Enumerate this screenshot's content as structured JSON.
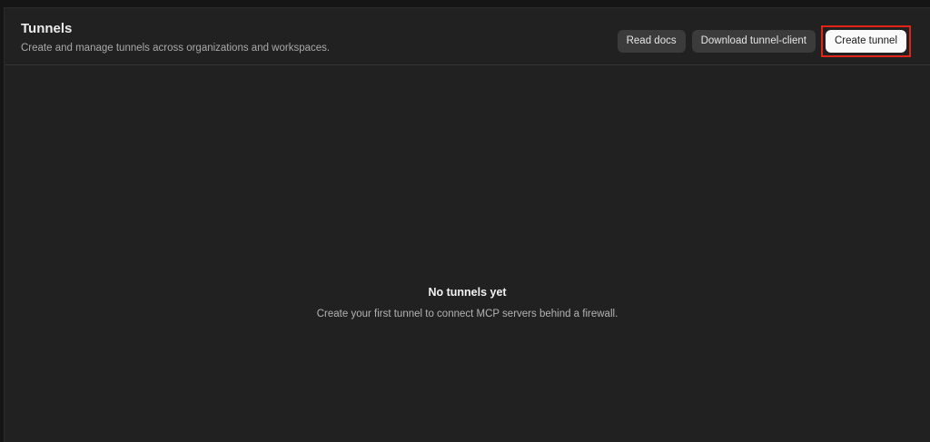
{
  "header": {
    "title": "Tunnels",
    "subtitle": "Create and manage tunnels across organizations and workspaces."
  },
  "actions": {
    "read_docs": "Read docs",
    "download_client": "Download tunnel-client",
    "create_tunnel": "Create tunnel"
  },
  "empty_state": {
    "title": "No tunnels yet",
    "description": "Create your first tunnel to connect MCP servers behind a firewall."
  },
  "colors": {
    "background": "#212121",
    "primary_button": "#fafafa",
    "secondary_button": "#3b3b3b",
    "highlight": "#e2231a"
  }
}
